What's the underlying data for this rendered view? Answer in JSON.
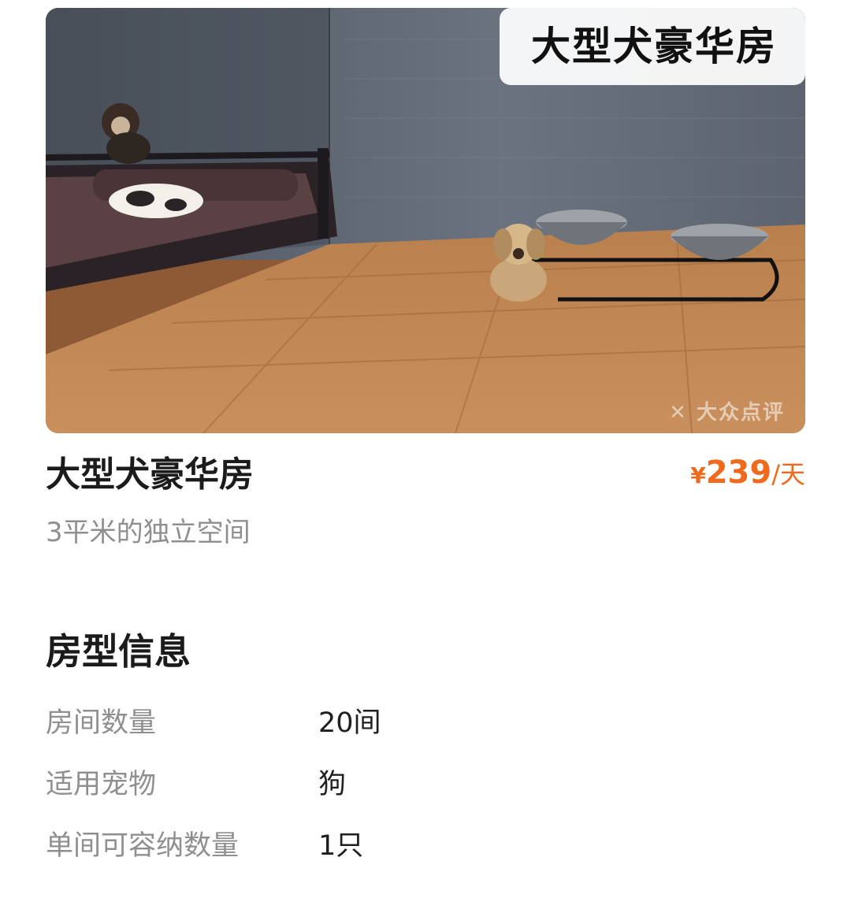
{
  "hero": {
    "tag_text": "大型犬豪华房",
    "watermark": "✕ 大众点评"
  },
  "room": {
    "title": "大型犬豪华房",
    "subtitle": "3平米的独立空间",
    "price": {
      "currency": "¥",
      "amount": "239",
      "unit": "/天",
      "color": "#f06a1e"
    }
  },
  "info": {
    "section_title": "房型信息",
    "rows": [
      {
        "key": "房间数量",
        "value": "20间"
      },
      {
        "key": "适用宠物",
        "value": "狗"
      },
      {
        "key": "单间可容纳数量",
        "value": "1只"
      }
    ]
  }
}
